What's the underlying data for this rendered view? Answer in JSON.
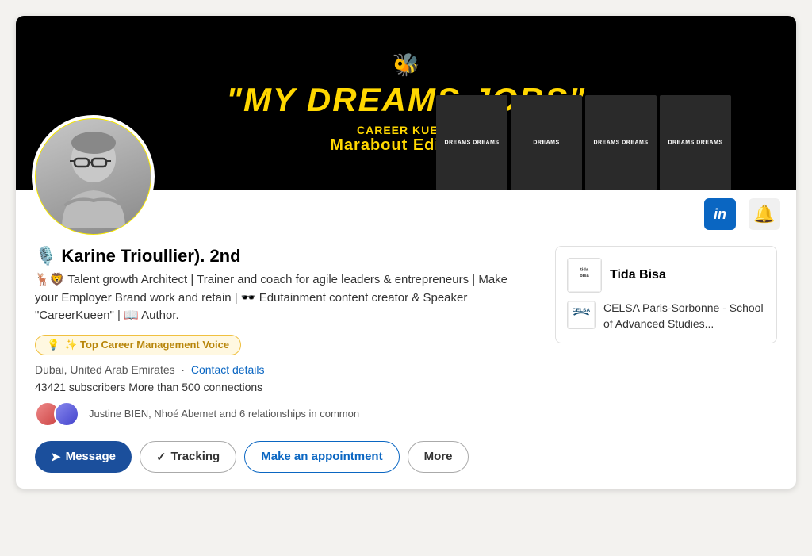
{
  "banner": {
    "bee_emoji": "🐝",
    "title": "\"MY DREAMS JOBS\"",
    "subtitle1": "CAREER KUEEN",
    "subtitle2": "Marabout Editions",
    "books": [
      {
        "label": "DREAMS DREAMS"
      },
      {
        "label": "DREAMS"
      },
      {
        "label": "DREAMS DREAMS"
      },
      {
        "label": "DREAMS DREAMS"
      }
    ]
  },
  "icons": {
    "linkedin": "in",
    "bell": "🔔"
  },
  "profile": {
    "name_emoji": "🎙️",
    "name": "Karine Trioullier). 2nd",
    "second_label": "2nd",
    "headline": "🦌🦁 Talent growth Architect | Trainer and coach for agile leaders & entrepreneurs | Make your Employer Brand work and retain | 🕶️ Edutainment content creator & Speaker \"CareerKueen\" | 📖 Author.",
    "badge": "✨ Top Career Management Voice",
    "badge_emoji": "💡",
    "location": "Dubai, United Arab Emirates",
    "contact_link": "Contact details",
    "stats": "43421 subscribers More than 500 connections",
    "mutual": "Justine BIEN, Nhoé Abemet and 6 relationships in common"
  },
  "buttons": {
    "message": "Message",
    "message_icon": "➤",
    "tracking": "Tracking",
    "tracking_icon": "✓",
    "appointment": "Make an appointment",
    "more": "More"
  },
  "sidebar": {
    "company_name": "Tida Bisa",
    "company_logo_text": "tidabisa",
    "edu_logo_text": "CELSA",
    "edu_name": "CELSA Paris-Sorbonne - School of Advanced Studies..."
  }
}
